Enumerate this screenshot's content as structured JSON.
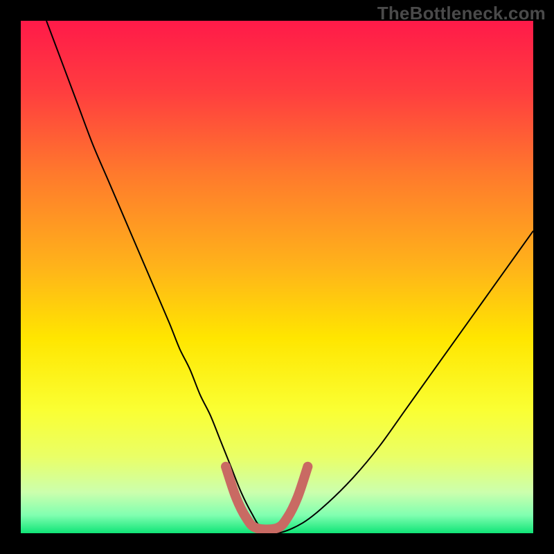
{
  "watermark": "TheBottleneck.com",
  "chart_data": {
    "type": "line",
    "title": "",
    "xlabel": "",
    "ylabel": "",
    "xlim": [
      0,
      100
    ],
    "ylim": [
      0,
      100
    ],
    "background_gradient": {
      "stops": [
        {
          "offset": 0.0,
          "color": "#ff1a49"
        },
        {
          "offset": 0.14,
          "color": "#ff3e3f"
        },
        {
          "offset": 0.3,
          "color": "#ff7a2c"
        },
        {
          "offset": 0.48,
          "color": "#ffb31a"
        },
        {
          "offset": 0.62,
          "color": "#ffe600"
        },
        {
          "offset": 0.76,
          "color": "#faff33"
        },
        {
          "offset": 0.85,
          "color": "#eaff66"
        },
        {
          "offset": 0.92,
          "color": "#ccffad"
        },
        {
          "offset": 0.965,
          "color": "#80ffb0"
        },
        {
          "offset": 1.0,
          "color": "#10e477"
        }
      ]
    },
    "series": [
      {
        "name": "bottleneck-curve",
        "stroke": "#000000",
        "stroke_width": 2,
        "x": [
          5,
          8,
          11,
          14,
          17,
          20,
          23,
          26,
          29,
          31,
          33,
          35,
          37,
          39,
          41,
          43,
          45,
          47,
          50,
          55,
          60,
          65,
          70,
          75,
          80,
          85,
          90,
          95,
          100
        ],
        "y": [
          100,
          92,
          84,
          76,
          69,
          62,
          55,
          48,
          41,
          36,
          32,
          27,
          23,
          18,
          13,
          8,
          4,
          1,
          0,
          2,
          6,
          11,
          17,
          24,
          31,
          38,
          45,
          52,
          59
        ]
      },
      {
        "name": "optimal-zone-marker",
        "stroke": "#c96a63",
        "stroke_width": 14,
        "linecap": "round",
        "x": [
          40,
          42,
          44,
          46,
          50,
          52,
          54,
          56
        ],
        "y": [
          13,
          7,
          3,
          1,
          1,
          3,
          7,
          13
        ]
      }
    ]
  }
}
